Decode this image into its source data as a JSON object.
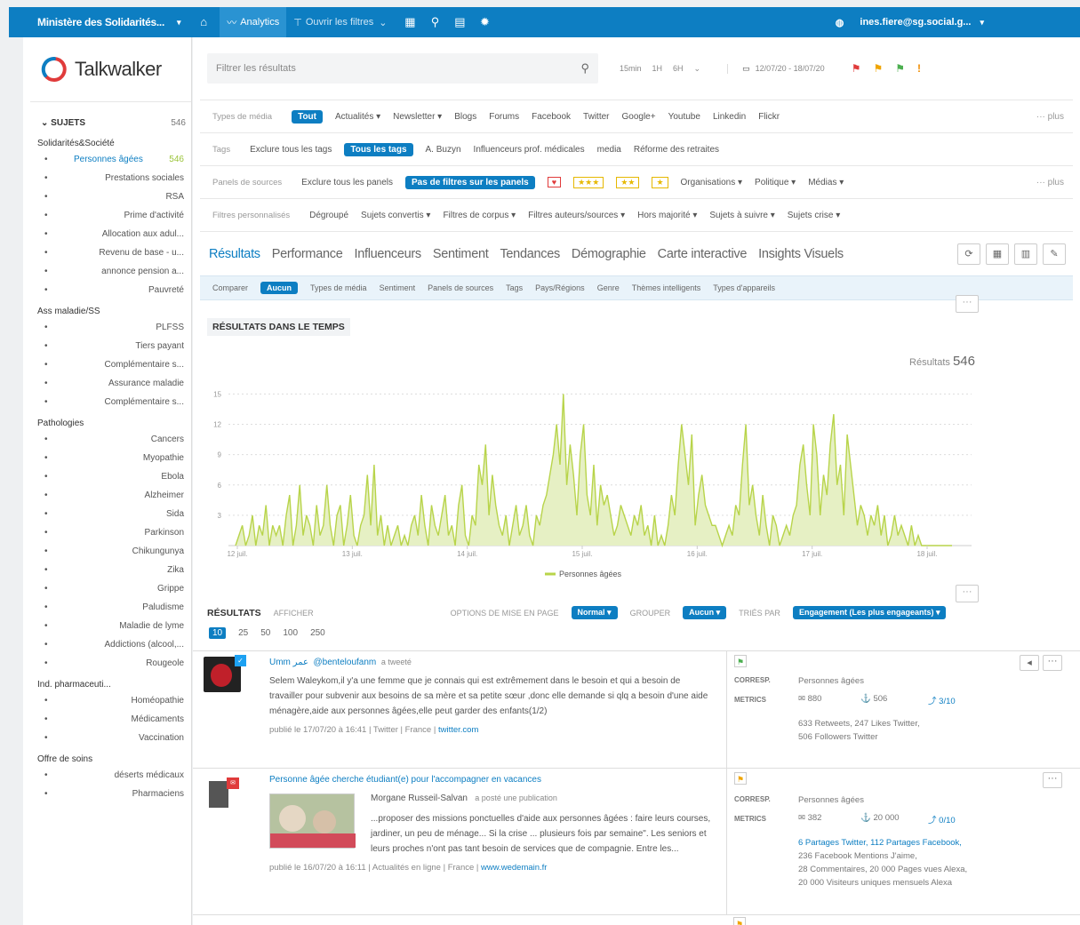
{
  "topbar": {
    "org": "Ministère des Solidarités...",
    "analytics": "Analytics",
    "open_filters": "Ouvrir les filtres",
    "user": "ines.fiere@sg.social.g..."
  },
  "logo": "Talkwalker",
  "sidebar": {
    "title": "SUJETS",
    "total": "546",
    "groups": [
      {
        "name": "Solidarités&Société",
        "items": [
          {
            "label": "Personnes âgées",
            "count": "546",
            "link": true
          },
          {
            "label": "Prestations sociales"
          },
          {
            "label": "RSA"
          },
          {
            "label": "Prime d'activité"
          },
          {
            "label": "Allocation aux adul..."
          },
          {
            "label": "Revenu de base - u..."
          },
          {
            "label": "annonce pension a..."
          },
          {
            "label": "Pauvreté"
          }
        ]
      },
      {
        "name": "Ass maladie/SS",
        "items": [
          {
            "label": "PLFSS"
          },
          {
            "label": "Tiers payant"
          },
          {
            "label": "Complémentaire s..."
          },
          {
            "label": "Assurance maladie"
          },
          {
            "label": "Complémentaire s..."
          }
        ]
      },
      {
        "name": "Pathologies",
        "items": [
          {
            "label": "Cancers"
          },
          {
            "label": "Myopathie"
          },
          {
            "label": "Ebola"
          },
          {
            "label": "Alzheimer"
          },
          {
            "label": "Sida"
          },
          {
            "label": "Parkinson"
          },
          {
            "label": "Chikungunya"
          },
          {
            "label": "Zika"
          },
          {
            "label": "Grippe"
          },
          {
            "label": "Paludisme"
          },
          {
            "label": "Maladie de lyme"
          },
          {
            "label": "Addictions (alcool,..."
          },
          {
            "label": "Rougeole"
          }
        ]
      },
      {
        "name": "Ind. pharmaceuti...",
        "items": [
          {
            "label": "Homéopathie"
          },
          {
            "label": "Médicaments"
          },
          {
            "label": "Vaccination"
          }
        ]
      },
      {
        "name": "Offre de soins",
        "items": [
          {
            "label": "déserts médicaux"
          },
          {
            "label": "Pharmaciens"
          }
        ]
      }
    ]
  },
  "search": {
    "placeholder": "Filtrer les résultats",
    "time_options": [
      "15min",
      "1H",
      "6H"
    ],
    "date_range": "12/07/20 - 18/07/20"
  },
  "filters": {
    "media": {
      "label": "Types de média",
      "items": [
        "Tout",
        "Actualités ▾",
        "Newsletter ▾",
        "Blogs",
        "Forums",
        "Facebook",
        "Twitter",
        "Google+",
        "Youtube",
        "Linkedin",
        "Flickr"
      ],
      "more": "··· plus"
    },
    "tags": {
      "label": "Tags",
      "items": [
        "Exclure tous les tags",
        "Tous les tags",
        "A. Buzyn",
        "Influenceurs prof. médicales",
        "media",
        "Réforme des retraites"
      ]
    },
    "panels": {
      "label": "Panels de sources",
      "items": [
        "Exclure tous les panels",
        "Pas de filtres sur les panels",
        "★★★",
        "★★",
        "★",
        "Organisations ▾",
        "Politique ▾",
        "Médias ▾"
      ],
      "more": "··· plus"
    },
    "custom": {
      "label": "Filtres personnalisés",
      "items": [
        "Dégroupé",
        "Sujets convertis ▾",
        "Filtres de corpus ▾",
        "Filtres auteurs/sources ▾",
        "Hors majorité ▾",
        "Sujets à suivre ▾",
        "Sujets crise ▾"
      ]
    }
  },
  "tabs": [
    "Résultats",
    "Performance",
    "Influenceurs",
    "Sentiment",
    "Tendances",
    "Démographie",
    "Carte interactive",
    "Insights Visuels"
  ],
  "compare": {
    "label": "Comparer",
    "items": [
      "Aucun",
      "Types de média",
      "Sentiment",
      "Panels de sources",
      "Tags",
      "Pays/Régions",
      "Genre",
      "Thèmes intelligents",
      "Types d'appareils"
    ]
  },
  "chart_card": {
    "title": "RÉSULTATS DANS LE TEMPS",
    "total_label": "Résultats",
    "total_value": "546"
  },
  "chart_data": {
    "type": "area",
    "yticks": [
      3,
      6,
      9,
      12,
      15
    ],
    "ylim": [
      0,
      16
    ],
    "xlabels": [
      "12 juil.",
      "13 juil.",
      "14 juil.",
      "15 juil.",
      "16 juil.",
      "17 juil.",
      "18 juil."
    ],
    "series": [
      {
        "name": "Personnes âgées",
        "color": "#b8d44a",
        "values": [
          0,
          1,
          2,
          0,
          1,
          3,
          0,
          2,
          1,
          4,
          0,
          2,
          1,
          2,
          0,
          3,
          5,
          0,
          2,
          6,
          1,
          3,
          2,
          0,
          4,
          1,
          2,
          6,
          2,
          0,
          3,
          4,
          0,
          2,
          5,
          1,
          0,
          2,
          3,
          7,
          2,
          8,
          1,
          3,
          0,
          2,
          0,
          1,
          2,
          0,
          1,
          0,
          2,
          3,
          1,
          5,
          2,
          0,
          4,
          2,
          1,
          3,
          5,
          1,
          2,
          0,
          4,
          6,
          1,
          0,
          3,
          2,
          8,
          6,
          10,
          3,
          7,
          4,
          2,
          1,
          3,
          0,
          2,
          4,
          1,
          2,
          4,
          1,
          0,
          3,
          2,
          4,
          5,
          7,
          9,
          12,
          8,
          15,
          6,
          10,
          7,
          3,
          9,
          12,
          5,
          3,
          8,
          2,
          6,
          4,
          5,
          3,
          1,
          2,
          4,
          3,
          2,
          1,
          3,
          2,
          4,
          1,
          2,
          0,
          3,
          0,
          1,
          0,
          2,
          5,
          3,
          8,
          12,
          9,
          6,
          11,
          2,
          5,
          7,
          4,
          3,
          2,
          2,
          1,
          0,
          1,
          2,
          1,
          4,
          3,
          8,
          12,
          4,
          6,
          3,
          1,
          5,
          2,
          0,
          3,
          2,
          0,
          1,
          2,
          1,
          3,
          4,
          8,
          10,
          6,
          3,
          12,
          9,
          3,
          7,
          5,
          10,
          13,
          6,
          8,
          3,
          11,
          8,
          5,
          2,
          4,
          3,
          1,
          3,
          2,
          4,
          1,
          3,
          0,
          1,
          3,
          1,
          2,
          1,
          0,
          2,
          0,
          1,
          0,
          0,
          0,
          0,
          0,
          0,
          0,
          0,
          0,
          0
        ]
      }
    ]
  },
  "results": {
    "title": "RÉSULTATS",
    "show": "AFFICHER",
    "layout_label": "OPTIONS DE MISE EN PAGE",
    "layout_value": "Normal ▾",
    "group_label": "GROUPER",
    "group_value": "Aucun ▾",
    "sort_label": "TRIÉS PAR",
    "sort_value": "Engagement (Les plus engageants) ▾",
    "pages": [
      "10",
      "25",
      "50",
      "100",
      "250"
    ]
  },
  "posts": [
    {
      "author": "Umm عمر",
      "handle": "@benteloufanm",
      "action": "a tweeté",
      "text": "Selem Waleykom,il y'a une femme que je connais qui est extrêmement dans le besoin et qui a besoin de travailler pour subvenir aux besoins de sa mère et sa petite sœur ,donc elle demande si qlq a besoin d'une aide ménagère,aide aux personnes âgées,elle peut garder des enfants(1/2)",
      "footer": "publié le 17/07/20 à 16:41 | Twitter | France | ",
      "footer_link": "twitter.com",
      "corresp_label": "CORRESP.",
      "corresp": "Personnes âgées",
      "metrics_label": "METRICS",
      "m1": "880",
      "m2": "506",
      "m3": "3/10",
      "stats1": "633 Retweets, 247 Likes Twitter,",
      "stats2": "506 Followers Twitter"
    },
    {
      "title": "Personne âgée cherche étudiant(e) pour l'accompagner en vacances",
      "author": "Morgane Russeil-Salvan",
      "action": "a posté une publication",
      "text": "...proposer des missions ponctuelles d'aide aux personnes âgées : faire leurs courses, jardiner, un peu de ménage... Si la crise ... plusieurs fois par semaine\". Les seniors et leurs proches n'ont pas tant besoin de services que de compagnie. Entre les...",
      "footer": "publié le 16/07/20 à 16:11 | Actualités en ligne | France | ",
      "footer_link": "www.wedemain.fr",
      "corresp_label": "CORRESP.",
      "corresp": "Personnes âgées",
      "metrics_label": "METRICS",
      "m1": "382",
      "m2": "20 000",
      "m3": "0/10",
      "stats1": "6 Partages Twitter, 112 Partages Facebook,",
      "stats2": "236 Facebook Mentions J'aime,",
      "stats3": "28 Commentaires, 20 000 Pages vues Alexa,",
      "stats4": "20 000 Visiteurs uniques mensuels Alexa"
    }
  ]
}
